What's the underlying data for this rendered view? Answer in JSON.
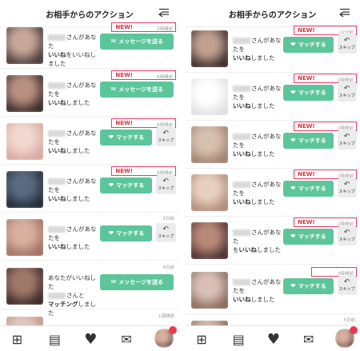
{
  "header": {
    "title": "お相手からのアクション",
    "filter_icon": "filter-back-icon"
  },
  "left_items": [
    {
      "avatar_colors": [
        "#4a3a3a",
        "#c8a898"
      ],
      "line1_suffix": "さんがあなた",
      "line2_bold": "",
      "line2": "をいいねしました",
      "line2_bold_part": "いいね",
      "new": "NEW!",
      "time": "2時間前",
      "action": "message",
      "button_label": "メッセージを送る"
    },
    {
      "avatar_colors": [
        "#3a2c28",
        "#b89080"
      ],
      "line1_suffix": "さんがあなたを",
      "line2_bold_part": "いいね",
      "line2": "しました",
      "new": "NEW!",
      "time": "6時間前",
      "action": "message",
      "button_label": "メッセージを送る"
    },
    {
      "avatar_colors": [
        "#d8a8a0",
        "#f0d8d0"
      ],
      "line1_suffix": "さんがあなたを",
      "line2_bold_part": "いいね",
      "line2": "しました",
      "new": "NEW!",
      "time": "8時間前",
      "action": "match",
      "button_label": "マッチする",
      "skip_label": "スキップ"
    },
    {
      "avatar_colors": [
        "#1e2a35",
        "#5a6a80"
      ],
      "line1_suffix": "さんがあなたを",
      "line2_bold_part": "いいね",
      "line2": "しました",
      "new": "NEW!",
      "time": "9時間前",
      "action": "match",
      "button_label": "マッチする",
      "skip_label": "スキップ"
    },
    {
      "avatar_colors": [
        "#a07060",
        "#d8b0a0"
      ],
      "line1_suffix": "さんがあなたを",
      "line2_bold_part": "いいね",
      "line2": "しました",
      "new": "",
      "time": "5日前",
      "action": "match",
      "button_label": "マッチする",
      "skip_label": "スキップ"
    },
    {
      "avatar_colors": [
        "#3a2828",
        "#a07868"
      ],
      "line1_prefix": "あなたがいいねした",
      "line1_suffix": "さんと",
      "line2_bold_part": "マッチング",
      "line2": "しました",
      "new": "",
      "time": "6日前",
      "action": "message",
      "button_label": "メッセージを送る"
    },
    {
      "avatar_colors": [
        "#c09080",
        "#e0c8c0"
      ],
      "line1_suffix": "",
      "line2_bold_part": "",
      "line2": "",
      "new": "",
      "time": "1週間前",
      "action": "none"
    }
  ],
  "right_items": [
    {
      "avatar_colors": [
        "#3a2a2a",
        "#c0a090"
      ],
      "line1_suffix": "さんがあなたを",
      "line2_bold_part": "いいね",
      "line2": "しました",
      "new": "NEW!",
      "time": "22分前",
      "action": "match",
      "button_label": "マッチする",
      "skip_label": "スキップ"
    },
    {
      "avatar_colors": [
        "#e0e0e0",
        "#ffffff"
      ],
      "line1_suffix": "さんがあなたを",
      "line2_bold_part": "いいね",
      "line2": "しました",
      "new": "NEW!",
      "time": "2時間前",
      "action": "match",
      "button_label": "マッチする",
      "skip_label": "スキップ"
    },
    {
      "avatar_colors": [
        "#a08070",
        "#d8c0b0"
      ],
      "line1_suffix": "さんがあなたを",
      "line2_bold_part": "いいね",
      "line2": "しました",
      "new": "NEW!",
      "time": "2時間前",
      "action": "match",
      "button_label": "マッチする",
      "skip_label": "スキップ"
    },
    {
      "avatar_colors": [
        "#b08a78",
        "#e8d0c0"
      ],
      "line1_suffix": "さんがあなたを",
      "line2_bold_part": "いいね",
      "line2": "しました",
      "new": "NEW!",
      "time": "2時間前",
      "action": "match",
      "button_label": "マッチする",
      "skip_label": "スキップ"
    },
    {
      "avatar_colors": [
        "#4a3030",
        "#b88878"
      ],
      "line1_suffix": "さんがあなた",
      "line2_bold_part": "いいね",
      "line2": "しました",
      "line2_prefix": "を",
      "new": "NEW!",
      "time": "2時間前",
      "action": "match",
      "button_label": "マッチする",
      "skip_label": "スキップ"
    },
    {
      "avatar_colors": [
        "#8a6858",
        "#d8c0b8"
      ],
      "line1_suffix": "さんがあなたを",
      "line2_bold_part": "いいね",
      "line2": "しました",
      "new": "",
      "time": "7時間前",
      "action": "match",
      "button_label": "マッチする",
      "skip_label": "スキップ",
      "boxed_time": true
    },
    {
      "avatar_colors": [
        "#8a6858",
        "#d8c0b8"
      ],
      "line1_suffix": "",
      "line2_bold_part": "",
      "line2": "",
      "new": "",
      "time": "5日前",
      "action": "none"
    }
  ],
  "footer": {
    "items": [
      {
        "name": "grid-icon",
        "glyph": "⊞"
      },
      {
        "name": "profile-card-icon",
        "glyph": "▤"
      },
      {
        "name": "heart-icon",
        "glyph": "♥"
      },
      {
        "name": "mail-icon",
        "glyph": "✉"
      },
      {
        "name": "my-avatar",
        "glyph": ""
      }
    ],
    "badge": ""
  },
  "colors": {
    "accent_green": "#5cc59a",
    "new_red": "#e03040",
    "highlight_box": "#e83a6a",
    "badge_red": "#e83a4f"
  }
}
